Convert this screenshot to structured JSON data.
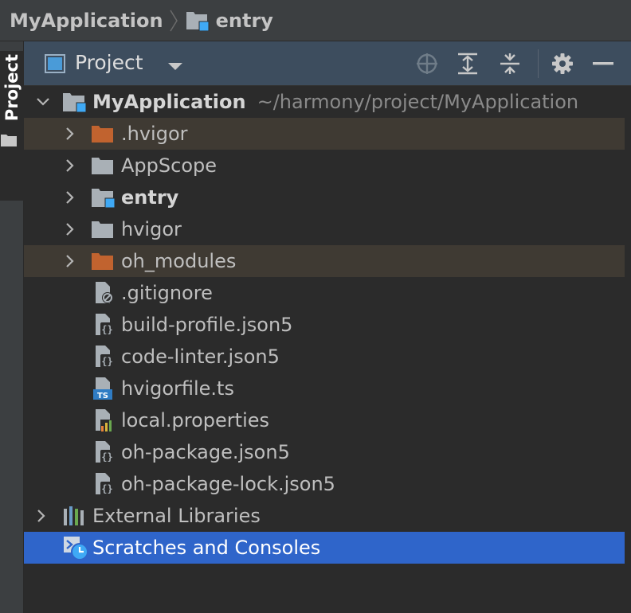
{
  "breadcrumb": {
    "root": "MyApplication",
    "current": "entry"
  },
  "tool_strip": {
    "project_tab": "Project"
  },
  "panel": {
    "title": "Project",
    "buttons": [
      "locate-icon",
      "expand-all-icon",
      "collapse-all-icon",
      "gear-icon",
      "minimize-icon"
    ]
  },
  "tree": {
    "root": {
      "label": "MyApplication",
      "path": "~/harmony/project/MyApplication"
    },
    "items": [
      {
        "label": ".hvigor",
        "type": "excluded-folder"
      },
      {
        "label": "AppScope",
        "type": "folder"
      },
      {
        "label": "entry",
        "type": "module-folder"
      },
      {
        "label": "hvigor",
        "type": "folder"
      },
      {
        "label": "oh_modules",
        "type": "excluded-folder"
      },
      {
        "label": ".gitignore",
        "type": "ignore-file"
      },
      {
        "label": "build-profile.json5",
        "type": "json5-file"
      },
      {
        "label": "code-linter.json5",
        "type": "json5-file"
      },
      {
        "label": "hvigorfile.ts",
        "type": "ts-file"
      },
      {
        "label": "local.properties",
        "type": "properties-file"
      },
      {
        "label": "oh-package.json5",
        "type": "json5-file"
      },
      {
        "label": "oh-package-lock.json5",
        "type": "json5-file"
      }
    ],
    "external_libraries": "External Libraries",
    "scratches": "Scratches and Consoles"
  },
  "colors": {
    "selection": "#2f65ca",
    "excluded_row": "#3f3a33",
    "excluded_folder": "#c1632f",
    "module_marker": "#3fa9f5"
  }
}
